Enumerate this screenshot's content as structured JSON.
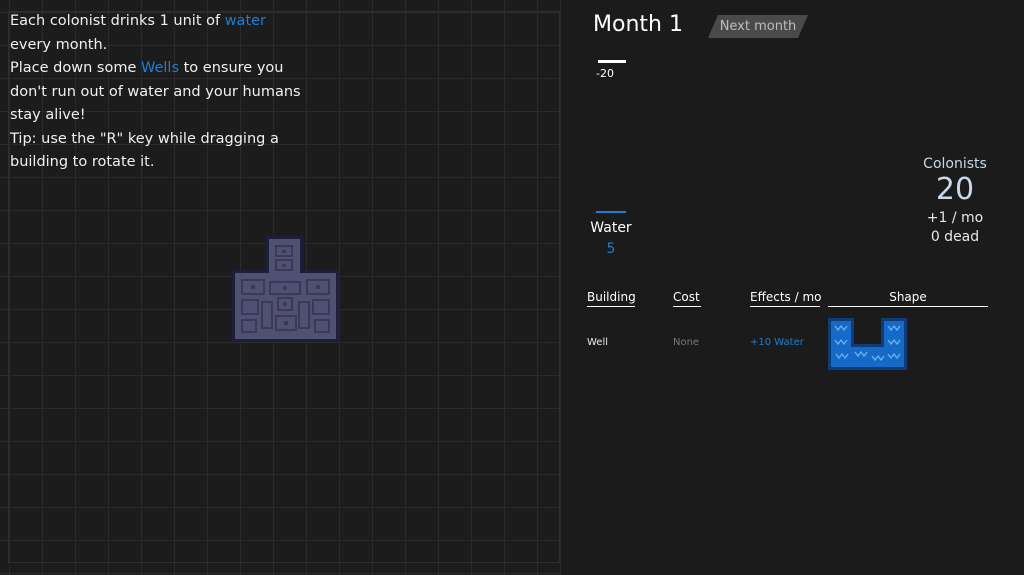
{
  "tutorial": {
    "line1_prefix": "Each colonist drinks 1 unit of ",
    "line1_highlight": "water",
    "line2": "every month.",
    "line3_prefix": "Place down some ",
    "line3_highlight": "Wells",
    "line3_suffix": " to ensure you",
    "line4": "don't run out of water and your humans",
    "line5": "stay alive!",
    "line6": "Tip: use the \"R\" key while dragging a",
    "line7": "building to rotate it."
  },
  "header": {
    "month_title": "Month 1",
    "next_month_label": "Next month"
  },
  "resources": {
    "water_delta": "-20",
    "water_label": "Water",
    "water_value": "5"
  },
  "colonists": {
    "label": "Colonists",
    "count": "20",
    "rate": "+1 / mo",
    "dead": "0 dead"
  },
  "buildings_table": {
    "headers": {
      "building": "Building",
      "cost": "Cost",
      "effects": "Effects / mo",
      "shape": "Shape"
    },
    "rows": [
      {
        "name": "Well",
        "cost": "None",
        "effect": "+10 Water"
      }
    ]
  },
  "colors": {
    "accent_blue": "#1b7fd6",
    "placed_building": "#505072",
    "background": "#1b1b1b"
  },
  "icons": {
    "placed_building": "well-building-icon",
    "shape_preview": "well-shape-icon"
  }
}
